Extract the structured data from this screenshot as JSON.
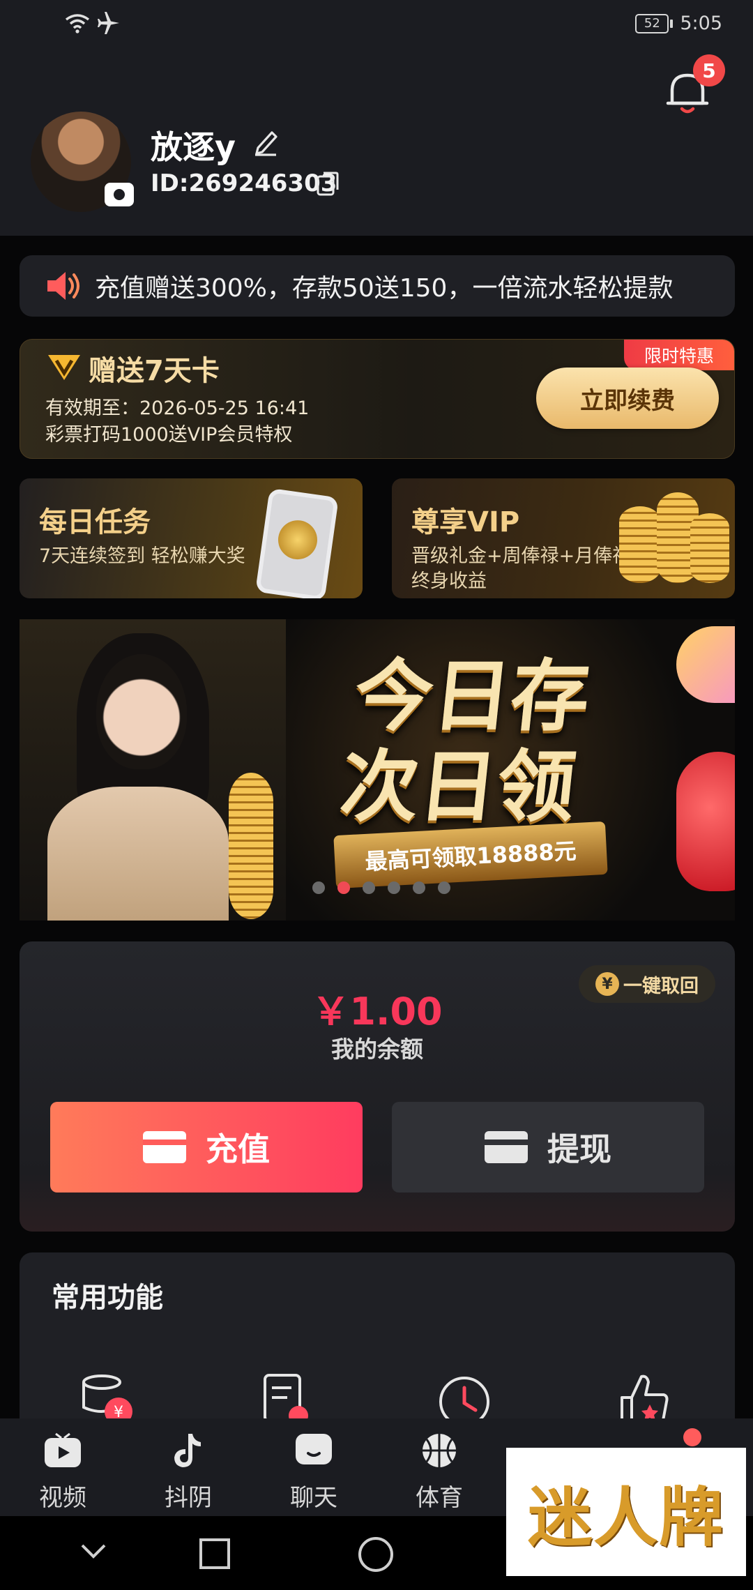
{
  "status_bar": {
    "battery": "52",
    "time": "5:05"
  },
  "notifications": {
    "badge_count": "5"
  },
  "profile": {
    "username": "放逐y",
    "user_id": "ID:269246303"
  },
  "notice": {
    "text": "充值赠送300%，存款50送150，一倍流水轻松提款"
  },
  "vip_card": {
    "title": "赠送7天卡",
    "tag": "限时特惠",
    "expiry": "有效期至：2026-05-25 16:41",
    "description": "彩票打码1000送VIP会员特权",
    "renew_label": "立即续费"
  },
  "promos": [
    {
      "title": "每日任务",
      "subtitle": "7天连续签到 轻松赚大奖"
    },
    {
      "title": "尊享VIP",
      "subtitle": "晋级礼金+周俸禄+月俸禄",
      "subtitle2": "终身收益"
    }
  ],
  "banner": {
    "line1": "今日存",
    "line2": "次日领",
    "ribbon": "最高可领取18888元",
    "active_slide": 2,
    "slide_count": 6
  },
  "wallet": {
    "amount": "￥1.00",
    "label": "我的余额",
    "recover_label": "一键取回",
    "recharge_label": "充值",
    "withdraw_label": "提现"
  },
  "functions": {
    "title": "常用功能",
    "icons": [
      "coins-icon",
      "bill-icon",
      "clock-icon",
      "thumbs-up-icon"
    ]
  },
  "tabs": [
    {
      "label": "视频",
      "icon": "tv-icon"
    },
    {
      "label": "抖阴",
      "icon": "tiktok-icon"
    },
    {
      "label": "聊天",
      "icon": "chat-icon"
    },
    {
      "label": "体育",
      "icon": "basketball-icon"
    }
  ],
  "watermark": {
    "text": "迷人牌"
  },
  "colors": {
    "accent": "#f8375a",
    "gold": "#f6dca5",
    "background": "#060607"
  }
}
